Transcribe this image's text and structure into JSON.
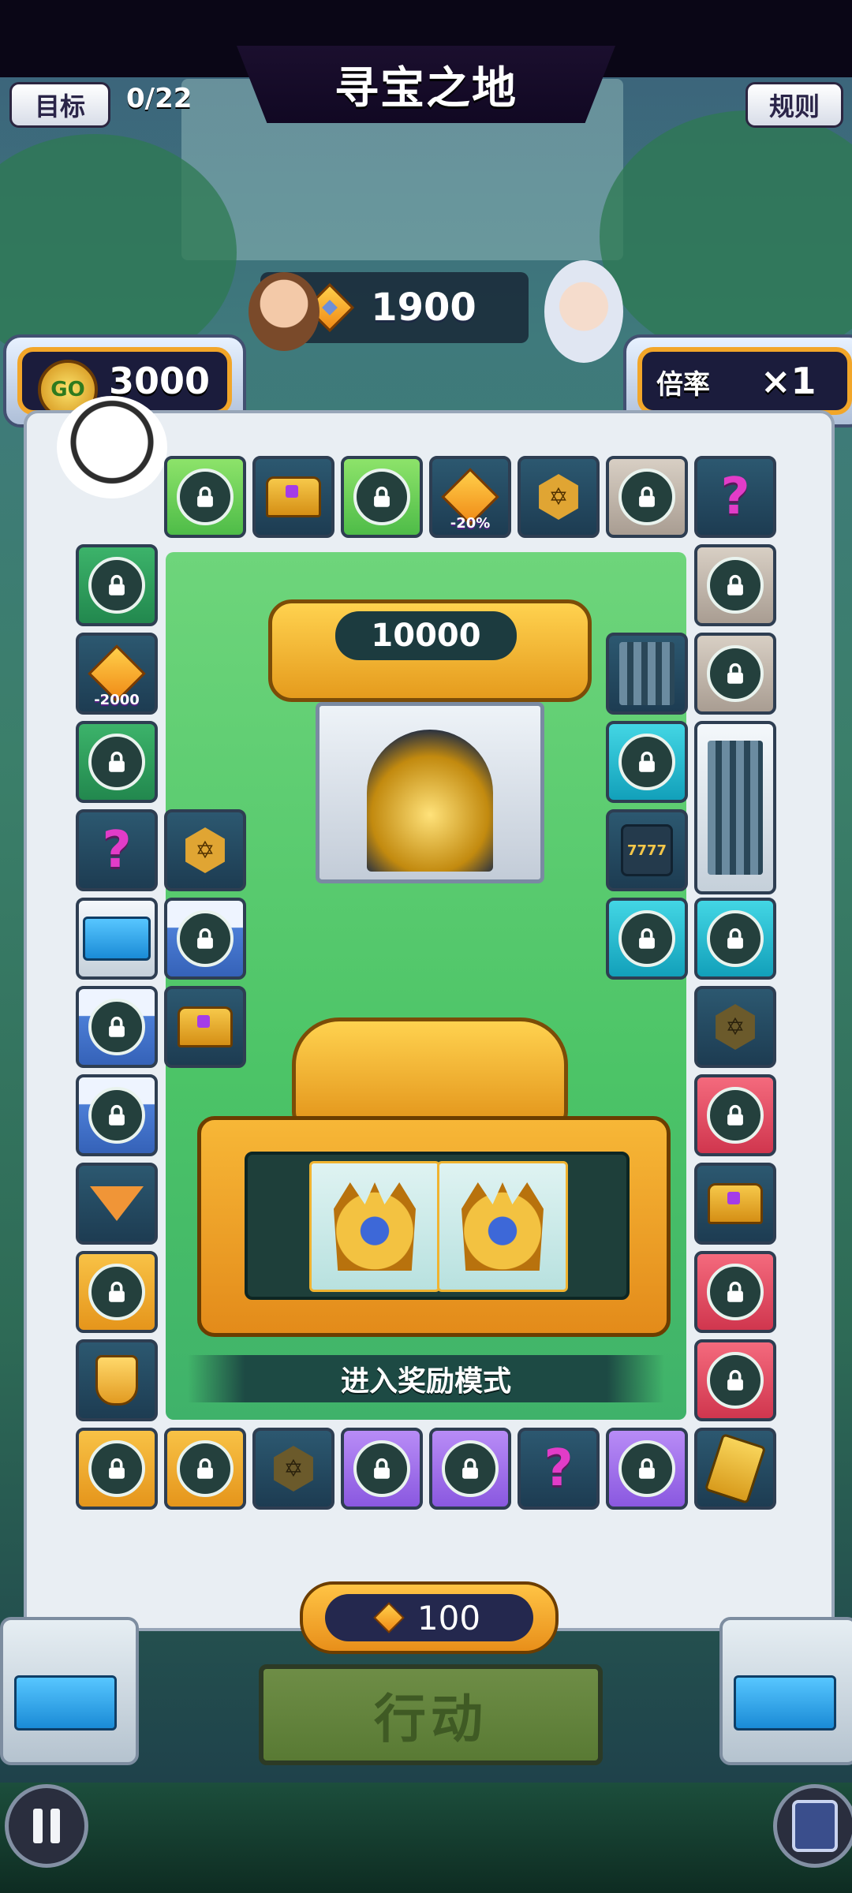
{
  "header": {
    "title": "寻宝之地",
    "goal_label": "目标",
    "progress": "0/22",
    "rules_label": "规则"
  },
  "gems": {
    "count": "1900"
  },
  "go_pod": {
    "icon_text": "GO",
    "value": "3000"
  },
  "multiplier": {
    "label": "倍率",
    "value": "×1"
  },
  "treasure": {
    "value": "10000"
  },
  "tiles": {
    "discount_label": "-20%",
    "minus_label": "-2000",
    "slot_label": "7777"
  },
  "slot": {
    "banner": "进入奖励模式"
  },
  "bottom": {
    "cost": "100",
    "action_label": "行动"
  },
  "colors": {
    "accent": "#f2a629",
    "board_green": "#4cc467"
  }
}
